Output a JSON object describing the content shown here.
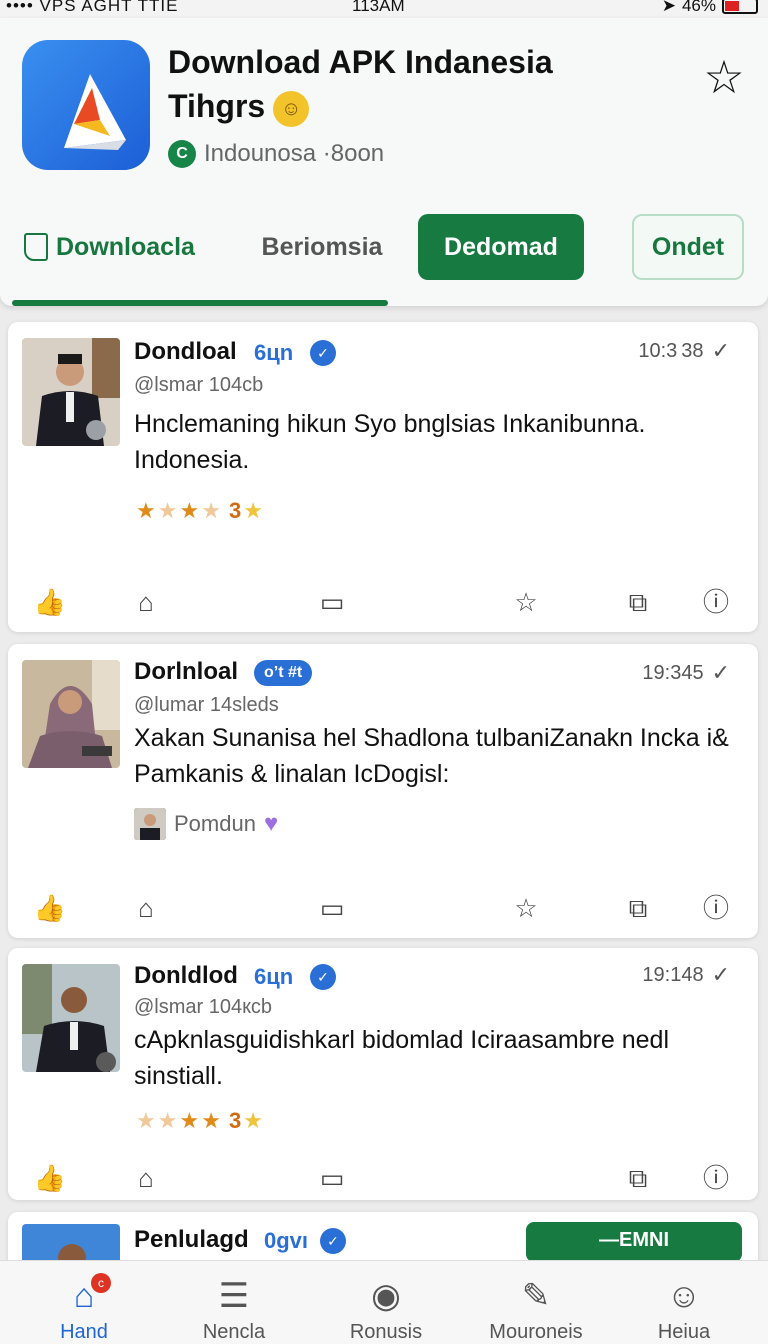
{
  "status_bar": {
    "left": "•••• VPS AGHT TTIE",
    "time": "113AM",
    "battery": "46%"
  },
  "app": {
    "title": "Download APK Indanesia Tihgrs",
    "region": "Indounosa ·8oon"
  },
  "tabs": [
    {
      "label": "Downloacla"
    },
    {
      "label": "Beriomsia"
    },
    {
      "label": "Dedomad"
    },
    {
      "label": "Ondet"
    }
  ],
  "posts": [
    {
      "name": "Dondloal",
      "badge": "6цn",
      "time": "10:3 38",
      "handle": "@lsmar 104cb",
      "text": "Hnclemaning hikun Syo bnglsias Inkanibunna. Indonesia.",
      "rating_text": "3"
    },
    {
      "name": "Dorlnloal",
      "badge": "o’t #t",
      "time": "19:345",
      "handle": "@lumar 14sleds",
      "text": "Xakan Sunanisa hel Shadlona tulbaniZanakn Incka i& Pamkanis & linalan IcDogisl:",
      "mention": "Pomdun"
    },
    {
      "name": "Donldlod",
      "badge": "6цn",
      "time": "19:148",
      "handle": "@lsmar 104кcb",
      "text": "cApknlasguidishkarl bidomlad Iciraasambre nedl sinstiall.",
      "rating_text": "3"
    },
    {
      "name": "Penlulagd",
      "badge": "0gvı",
      "follow": "—EMNI"
    }
  ],
  "bottom_nav": [
    {
      "label": "Hand",
      "icon": "home-icon"
    },
    {
      "label": "Nencla",
      "icon": "news-icon"
    },
    {
      "label": "Ronusis",
      "icon": "record-icon"
    },
    {
      "label": "Mouroneis",
      "icon": "tools-icon"
    },
    {
      "label": "Heiua",
      "icon": "profile-icon"
    }
  ],
  "colors": {
    "accent_green": "#167a41",
    "accent_blue": "#2a6fd6"
  }
}
